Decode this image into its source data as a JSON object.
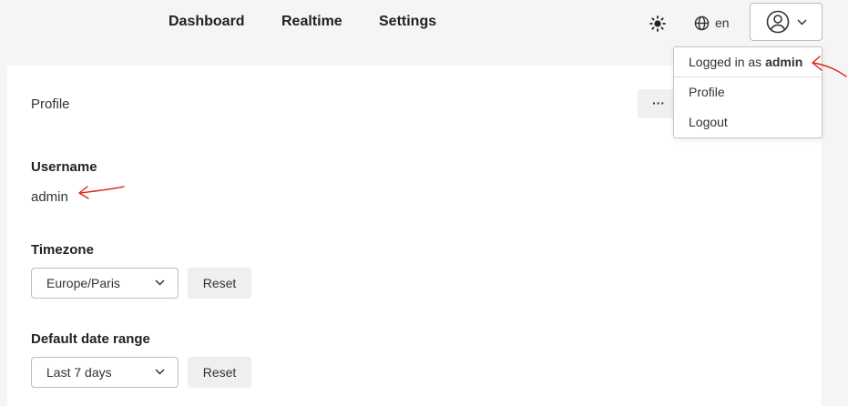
{
  "nav": {
    "dashboard": "Dashboard",
    "realtime": "Realtime",
    "settings": "Settings"
  },
  "header": {
    "theme_icon": "sun-icon",
    "language_icon": "globe-icon",
    "language": "en",
    "user_icon": "user-circle-icon"
  },
  "user_menu": {
    "logged_in_prefix": "Logged in as",
    "username": "admin",
    "items": [
      "Profile",
      "Logout"
    ]
  },
  "profile": {
    "title": "Profile",
    "more_label": "···",
    "username_label": "Username",
    "username_value": "admin",
    "timezone_label": "Timezone",
    "timezone_value": "Europe/Paris",
    "timezone_reset": "Reset",
    "date_range_label": "Default date range",
    "date_range_value": "Last 7 days",
    "date_range_reset": "Reset"
  },
  "colors": {
    "background": "#f5f5f5",
    "card": "#ffffff",
    "annotation": "#e0201c"
  }
}
